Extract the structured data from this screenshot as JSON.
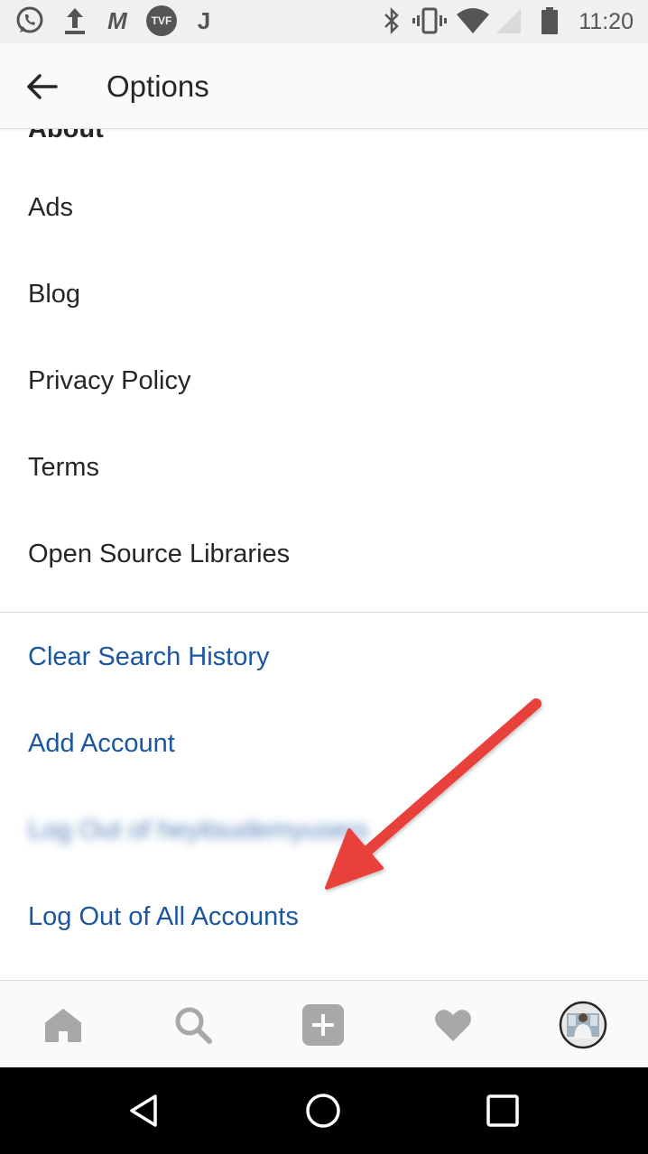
{
  "status_bar": {
    "time": "11:20",
    "left_icons": [
      "whatsapp-icon",
      "upload-icon",
      "m-app-icon",
      "tvf-app-icon",
      "j-app-icon"
    ],
    "tvf_label": "TVF",
    "m_label": "M",
    "j_label": "J",
    "right_icons": [
      "bluetooth-icon",
      "vibrate-icon",
      "wifi-icon",
      "signal-icon",
      "battery-icon"
    ]
  },
  "header": {
    "title": "Options"
  },
  "options": {
    "partial_top_item": "About",
    "items": [
      "Ads",
      "Blog",
      "Privacy Policy",
      "Terms",
      "Open Source Libraries"
    ],
    "actions": {
      "clear_search_history": "Clear Search History",
      "add_account": "Add Account",
      "log_out_account": "Log Out of heyitsudemyusers",
      "log_out_all": "Log Out of All Accounts"
    }
  },
  "annotation": {
    "color": "#e8403a",
    "target": "Log Out of All Accounts"
  },
  "tab_bar": {
    "tabs": [
      "home-icon",
      "search-icon",
      "add-post-icon",
      "activity-heart-icon",
      "profile-avatar"
    ]
  },
  "nav_bar": {
    "buttons": [
      "back-triangle-icon",
      "home-circle-icon",
      "recents-square-icon"
    ]
  },
  "colors": {
    "link_blue": "#1b56a0",
    "text_dark": "#262626",
    "icon_grey": "#a8a8a8",
    "annotation_red": "#e8403a"
  }
}
